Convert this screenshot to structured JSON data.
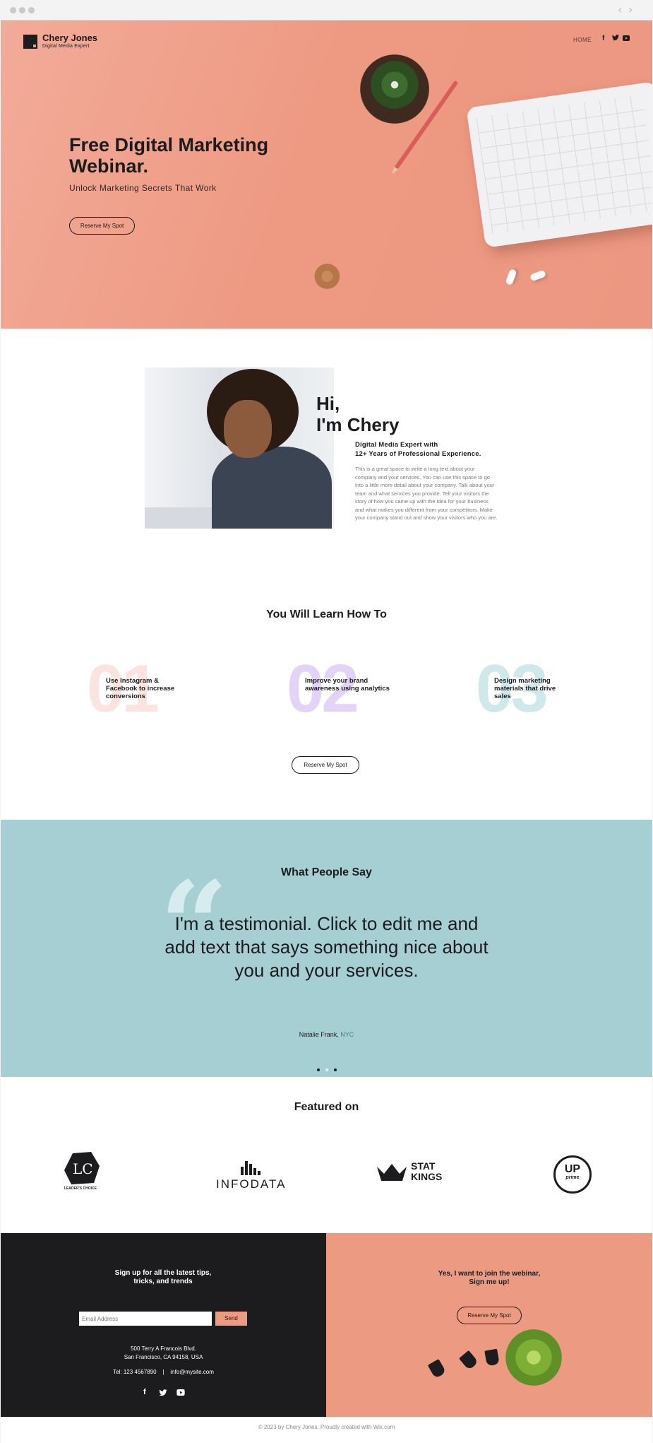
{
  "browser": {
    "back": "‹",
    "forward": "›"
  },
  "header": {
    "brand_name": "Chery Jones",
    "brand_sub": "Digital Media Expert",
    "nav_home": "HOME",
    "social": {
      "facebook": "f",
      "twitter": "t",
      "youtube": "▶"
    }
  },
  "hero": {
    "title": "Free Digital Marketing Webinar.",
    "subtitle": "Unlock Marketing Secrets That Work",
    "cta": "Reserve My Spot"
  },
  "about": {
    "greeting_line1": "Hi,",
    "greeting_line2": "I'm Chery",
    "subtitle_line1": "Digital Media Expert with",
    "subtitle_line2": "12+ Years of Professional Experience.",
    "body": "This is a great space to write a long text about your company and your services. You can use this space to go into a little more detail about your company. Talk about your team and what services you provide. Tell your visitors the story of how you came up with the idea for your business and what makes you different from your competitors. Make your company stand out and show your visitors who you are."
  },
  "learn": {
    "title": "You Will Learn How To",
    "items": [
      {
        "num": "01",
        "text": "Use Instagram & Facebook to increase conversions",
        "color": "#fbe3df"
      },
      {
        "num": "02",
        "text": "Improve your brand awareness using analytics",
        "color": "#e4d3f8"
      },
      {
        "num": "03",
        "text": "Design marketing materials that drive sales",
        "color": "#cfe8e9"
      }
    ],
    "cta": "Reserve My Spot"
  },
  "testimonial": {
    "title": "What People Say",
    "text": "I'm a testimonial. Click to edit me and add text that says something nice about you and your services.",
    "author": "Natalie Frank,",
    "location": "NYC"
  },
  "featured": {
    "title": "Featured on",
    "logos": {
      "leaders_choice_mark": "LC",
      "leaders_choice_caption": "LEADER'S CHOICE",
      "infodata": "INFODATA",
      "stat_line1": "STAT",
      "stat_line2": "KINGS",
      "up_line1": "UP",
      "up_line2": "prime"
    }
  },
  "footer": {
    "signup_title_line1": "Sign up for all the latest tips,",
    "signup_title_line2": "tricks, and trends",
    "email_placeholder": "Email Address",
    "send": "Send",
    "address_line1": "500 Terry A Francois Blvd.",
    "address_line2": "San Francisco, CA 94158, USA",
    "contact": "Tel: 123 4567890    |    info@mysite.com",
    "join_line1": "Yes, I want to join the webinar,",
    "join_line2": "Sign me up!",
    "cta": "Reserve My Spot",
    "social": {
      "facebook": "f",
      "twitter": "t",
      "youtube": "▶"
    },
    "copyright": "© 2023 by Chery Jones. Proudly created with Wix.com"
  },
  "colors": {
    "accent": "#ed9a82",
    "dark": "#1c1c1f",
    "teal": "#a6cfd3"
  }
}
